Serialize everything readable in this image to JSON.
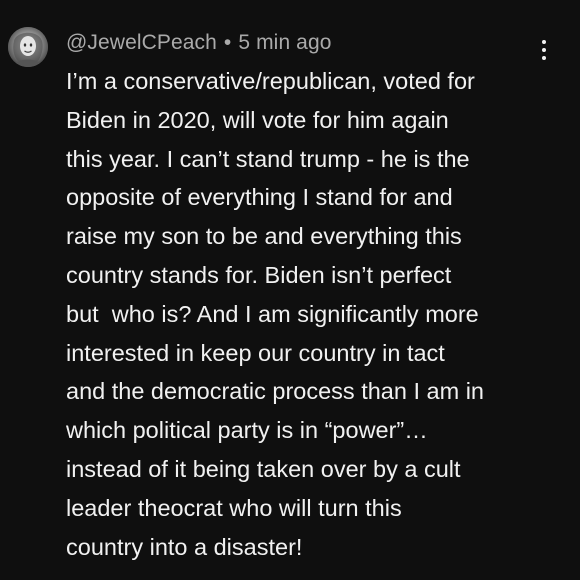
{
  "comment": {
    "username": "@JewelCPeach",
    "separator": "•",
    "time_ago": "5 min ago",
    "menu_icon": "more-vert-icon",
    "avatar_icon": "user-avatar",
    "text_lines": [
      "I’m a conservative/republican, voted for",
      "Biden in 2020, will vote for him again",
      "this year. I can’t stand trump - he is the",
      "opposite of everything I stand for and",
      "raise my son to be and everything this",
      "country stands for. Biden isn’t perfect",
      "but  who is? And I am significantly more",
      "interested in keep our country in tact",
      "and the democratic process than I am in",
      "which political party is in “power”…",
      "instead of it being taken over by a cult",
      "leader theocrat who will turn this",
      "country into a disaster!"
    ]
  }
}
